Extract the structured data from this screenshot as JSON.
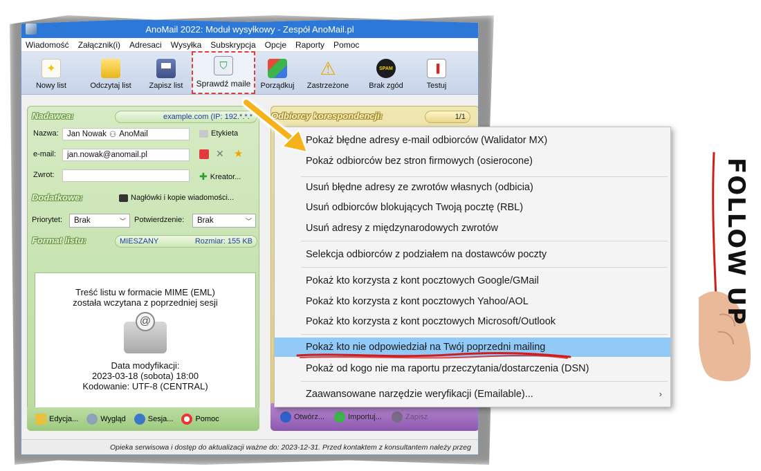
{
  "window": {
    "title": "AnoMail 2022: Moduł wysyłkowy - Zespół AnoMail.pl"
  },
  "menu": [
    "Wiadomość",
    "Załącznik(i)",
    "Adresaci",
    "Wysyłka",
    "Subskrypcja",
    "Opcje",
    "Raporty",
    "Pomoc"
  ],
  "toolbar": {
    "new": "Nowy list",
    "open": "Odczytaj list",
    "save": "Zapisz list",
    "check": "Sprawdź maile",
    "tidy": "Porządkuj",
    "reserved": "Zastrzeżone",
    "no_consent": "Brak zgód",
    "test": "Testuj"
  },
  "sender": {
    "heading": "Nadawca:",
    "domain_info": "example.com (IP: 192.*.*.*",
    "name_label": "Nazwa:",
    "name_value": "Jan Nowak",
    "alias": "AnoMail",
    "labels_btn": "Etykieta",
    "email_label": "e-mail:",
    "email_value": "jan.nowak@anomail.pl",
    "return_label": "Zwrot:",
    "return_value": "",
    "creator_btn": "Kreator..."
  },
  "extra": {
    "heading": "Dodatkowe:",
    "headers_btn": "Nagłówki i kopie wiadomości...",
    "priority_label": "Priorytet:",
    "priority_value": "Brak",
    "confirm_label": "Potwierdzenie:",
    "confirm_value": "Brak"
  },
  "format": {
    "heading": "Format listu:",
    "type": "MIESZANY",
    "size": "Rozmiar: 155 KB"
  },
  "preview": {
    "line1": "Treść listu w formacie MIME (EML)",
    "line2": "została wczytana z poprzedniej sesji",
    "mod_label": "Data modyfikacji:",
    "mod_date": "2023-03-18 (sobota) 18:00",
    "encoding": "Kodowanie: UTF-8 (CENTRAL)"
  },
  "left_footer": {
    "edit": "Edycja...",
    "view": "Wygląd",
    "session": "Sesja...",
    "help": "Pomoc"
  },
  "recipients": {
    "heading": "Odbiorcy korespondencji:",
    "page": "1/1"
  },
  "right_footer": {
    "open": "Otwórz...",
    "import": "Importuj...",
    "save": "Zapisz"
  },
  "context_menu": [
    "Pokaż błędne adresy e-mail odbiorców (Walidator MX)",
    "Pokaż odbiorców bez stron firmowych (osierocone)",
    "Usuń błędne adresy ze zwrotów własnych (odbicia)",
    "Usuń odbiorców blokujących Twoją pocztę (RBL)",
    "Usuń adresy z międzynarodowych zwrotów",
    "Selekcja odbiorców z podziałem na dostawców poczty",
    "Pokaż kto korzysta z kont pocztowych Google/GMail",
    "Pokaż kto korzysta z kont pocztowych Yahoo/AOL",
    "Pokaż kto korzysta z kont pocztowych Microsoft/Outlook",
    "Pokaż kto nie odpowiedział na Twój poprzedni mailing",
    "Pokaż od kogo nie ma raportu przeczytania/dostarczenia (DSN)",
    "Zaawansowane narzędzie weryfikacji (Emailable)..."
  ],
  "status": "Opieka serwisowa i dostęp do aktualizacji ważne do: 2023-12-31. Przed kontaktem z konsultantem należy przeg",
  "follow_up": "FOLLOW UP",
  "colors": {
    "titlebar": "#2b78d8",
    "highlight_row": "#91c9f7",
    "dashed_box": "#e23b3b",
    "annotation_arrow": "#f5b21a"
  },
  "icons": [
    "app-icon",
    "new-doc-icon",
    "folder-icon",
    "floppy-icon",
    "shield-mail-icon",
    "boxes-icon",
    "warning-icon",
    "spam-block-icon",
    "mailbox-icon",
    "tag-icon",
    "lock-icon",
    "tools-icon",
    "star-icon",
    "plus-icon",
    "email-envelope-icon",
    "hand-icon"
  ]
}
